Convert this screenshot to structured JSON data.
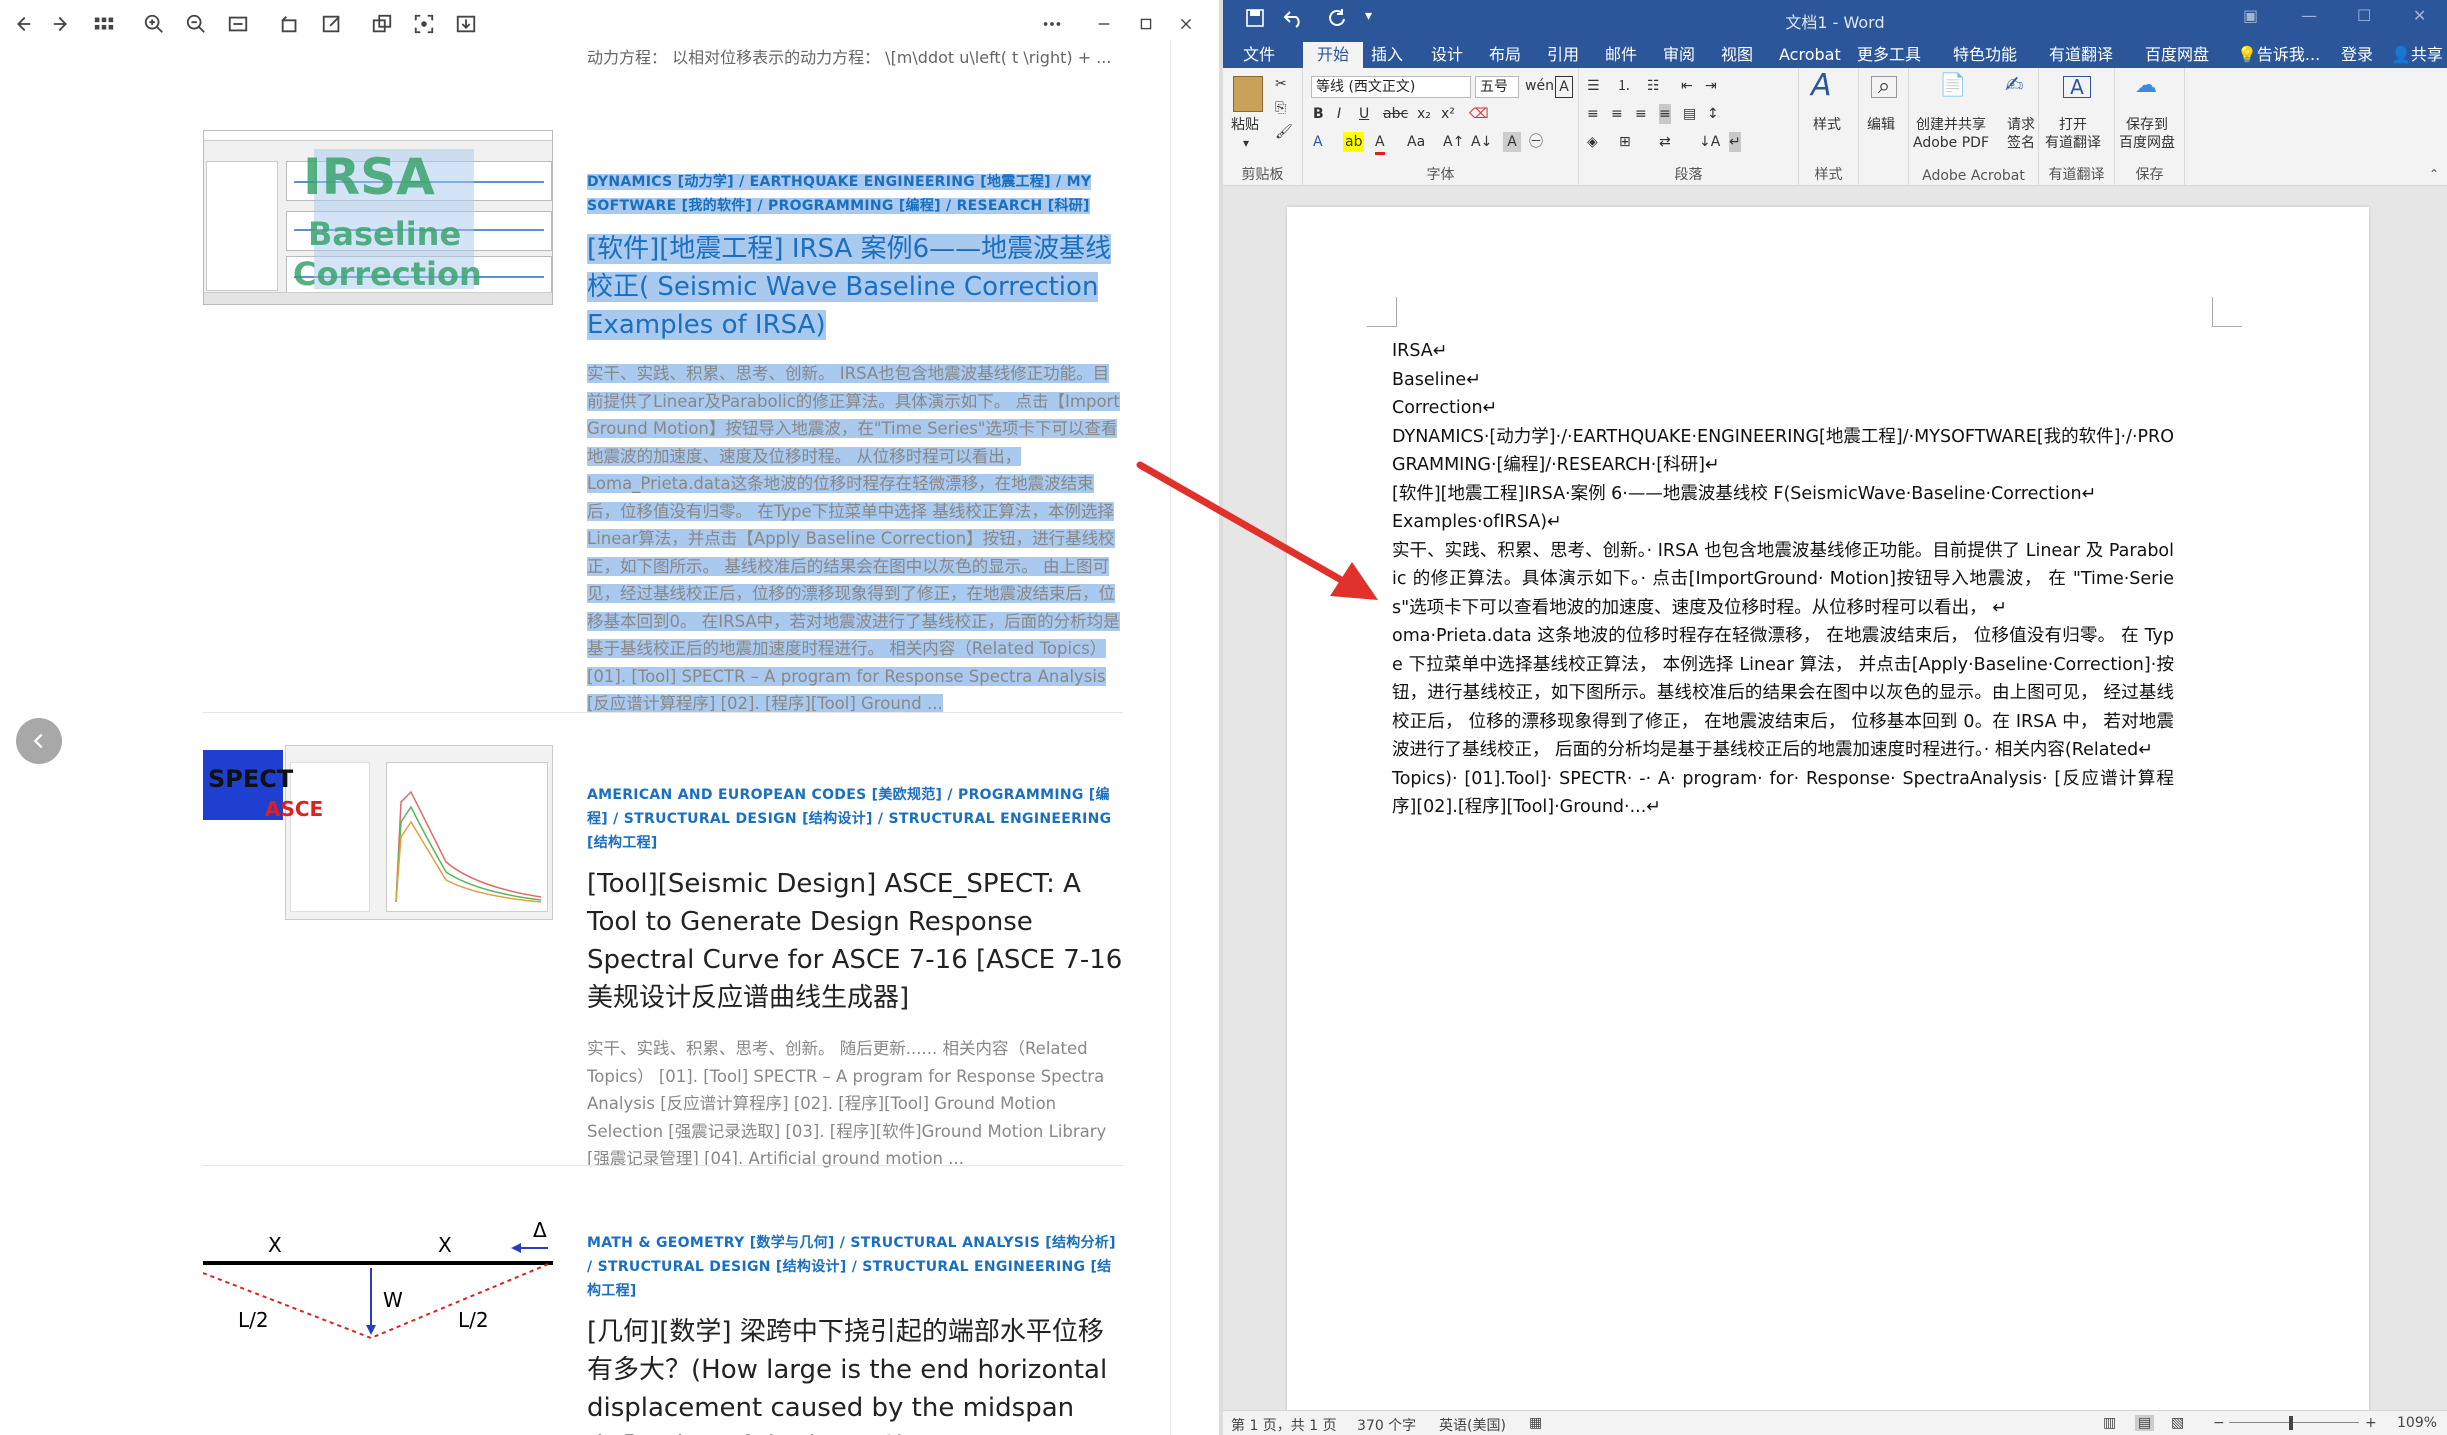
{
  "browser": {
    "top_line": "动力方程：  以相对位移表示的动力方程：  \\[m\\ddot u\\left( t \\right) + ...",
    "posts": [
      {
        "categories": "DYNAMICS [动力学] / EARTHQUAKE ENGINEERING [地震工程] / MY SOFTWARE [我的软件] / PROGRAMMING [编程] / RESEARCH [科研]",
        "title": "[软件][地震工程] IRSA 案例6——地震波基线校正( Seismic Wave Baseline Correction Examples of IRSA)",
        "excerpt": "实干、实践、积累、思考、创新。 IRSA也包含地震波基线修正功能。目前提供了Linear及Parabolic的修正算法。具体演示如下。 点击【Import Ground Motion】按钮导入地震波，在\"Time Series\"选项卡下可以查看地震波的加速度、速度及位移时程。 从位移时程可以看出，Loma_Prieta.data这条地波的位移时程存在轻微漂移，在地震波结束后，位移值没有归零。 在Type下拉菜单中选择 基线校正算法，本例选择Linear算法，并点击【Apply Baseline Correction】按钮，进行基线校正，如下图所示。 基线校准后的结果会在图中以灰色的显示。 由上图可见，经过基线校正后，位移的漂移现象得到了修正，在地震波结束后，位移基本回到0。 在IRSA中，若对地震波进行了基线校正，后面的分析均是基于基线校正后的地震加速度时程进行。 相关内容（Related Topics） [01]. [Tool] SPECTR – A program for Response Spectra Analysis [反应谱计算程序] [02]. [程序][Tool] Ground ...",
        "thumb_text": [
          "IRSA",
          "Baseline",
          "Correction"
        ]
      },
      {
        "categories": "AMERICAN AND EUROPEAN CODES [美欧规范] / PROGRAMMING [编程] / STRUCTURAL DESIGN [结构设计] / STRUCTURAL ENGINEERING [结构工程]",
        "title": "[Tool][Seismic Design] ASCE_SPECT: A Tool to Generate Design Response Spectral Curve for ASCE 7-16 [ASCE 7-16 美规设计反应谱曲线生成器]",
        "excerpt": "实干、实践、积累、思考、创新。 随后更新...... 相关内容（Related Topics） [01]. [Tool] SPECTR – A program for Response Spectra Analysis [反应谱计算程序] [02]. [程序][Tool] Ground Motion Selection [强震记录选取] [03]. [程序][软件]Ground Motion Library [强震记录管理] [04]. Artificial ground motion ...",
        "thumb_text": [
          "SPECT",
          "ASCE"
        ]
      },
      {
        "categories": "MATH & GEOMETRY [数学与几何] / STRUCTURAL ANALYSIS [结构分析] / STRUCTURAL DESIGN [结构设计] / STRUCTURAL ENGINEERING [结构工程]",
        "title": "[几何][数学] 梁跨中下挠引起的端部水平位移有多大？(How large is the end horizontal displacement caused by the midspan deflection of the beam?)",
        "thumb_text": [
          "X",
          "X",
          "Δ",
          "W",
          "L/2",
          "L/2"
        ]
      }
    ]
  },
  "word": {
    "title": "文档1 - Word",
    "tabs": [
      "文件",
      "开始",
      "插入",
      "设计",
      "布局",
      "引用",
      "邮件",
      "审阅",
      "视图",
      "Acrobat",
      "更多工具",
      "特色功能",
      "有道翻译",
      "百度网盘",
      "告诉我...",
      "登录",
      "共享"
    ],
    "ribbon": {
      "paste": "粘贴",
      "clipboard": "剪贴板",
      "font_name": "等线 (西文正文)",
      "font_size": "五号",
      "font_group": "字体",
      "paragraph_group": "段落",
      "styles": "样式",
      "styles_group": "样式",
      "edit": "编辑",
      "adobe_create": "创建并共享",
      "adobe_pdf": "Adobe PDF",
      "adobe_sign": "请求",
      "adobe_sign2": "签名",
      "adobe_group": "Adobe Acrobat",
      "youdao_open": "打开",
      "youdao_label": "有道翻译",
      "youdao_group": "有道翻译",
      "baidu_save": "保存到",
      "baidu_label": "百度网盘",
      "baidu_group": "保存"
    },
    "document_lines": [
      "IRSA↵",
      "Baseline↵",
      "Correction↵",
      "DYNAMICS·[动力学]·/·EARTHQUAKE·ENGINEERING[地震工程]/·MYSOFTWARE[我的软件]·/·PROGRAMMING·[编程]/·RESEARCH·[科研]↵",
      "[软件][地震工程]IRSA·案例 6·——地震波基线校 F(SeismicWave·Baseline·Correction↵",
      "Examples·ofIRSA)↵",
      "实干、实践、积累、思考、创新。· IRSA 也包含地震波基线修正功能。目前提供了 Linear 及 Parabolic 的修正算法。具体演示如下。· 点击[ImportGround· Motion]按钮导入地震波， 在 \"Time·Series\"选项卡下可以查看地波的加速度、速度及位移时程。从位移时程可以看出， ↵",
      "oma·Prieta.data 这条地波的位移时程存在轻微漂移， 在地震波结束后， 位移值没有归零。 在 Type 下拉菜单中选择基线校正算法， 本例选择 Linear 算法， 并点击[Apply·Baseline·Correction]·按钮，进行基线校正，如下图所示。基线校准后的结果会在图中以灰色的显示。由上图可见， 经过基线校正后， 位移的漂移现象得到了修正， 在地震波结束后， 位移基本回到 0。在 IRSA 中， 若对地震波进行了基线校正， 后面的分析均是基于基线校正后的地震加速度时程进行。· 相关内容(Related↵",
      "Topics)· [01].Tool]· SPECTR· -· A· program· for· Response· SpectraAnalysis· [反应谱计算程序][02].[程序][Tool]·Ground·...↵"
    ],
    "status": {
      "page": "第 1 页，共 1 页",
      "words": "370 个字",
      "language": "英语(美国)",
      "zoom": "109%"
    }
  },
  "colors": {
    "word_blue": "#2b579a",
    "link_blue": "#1a6fbf",
    "selection": "#a9c9ef",
    "arrow_red": "#e0312b"
  }
}
